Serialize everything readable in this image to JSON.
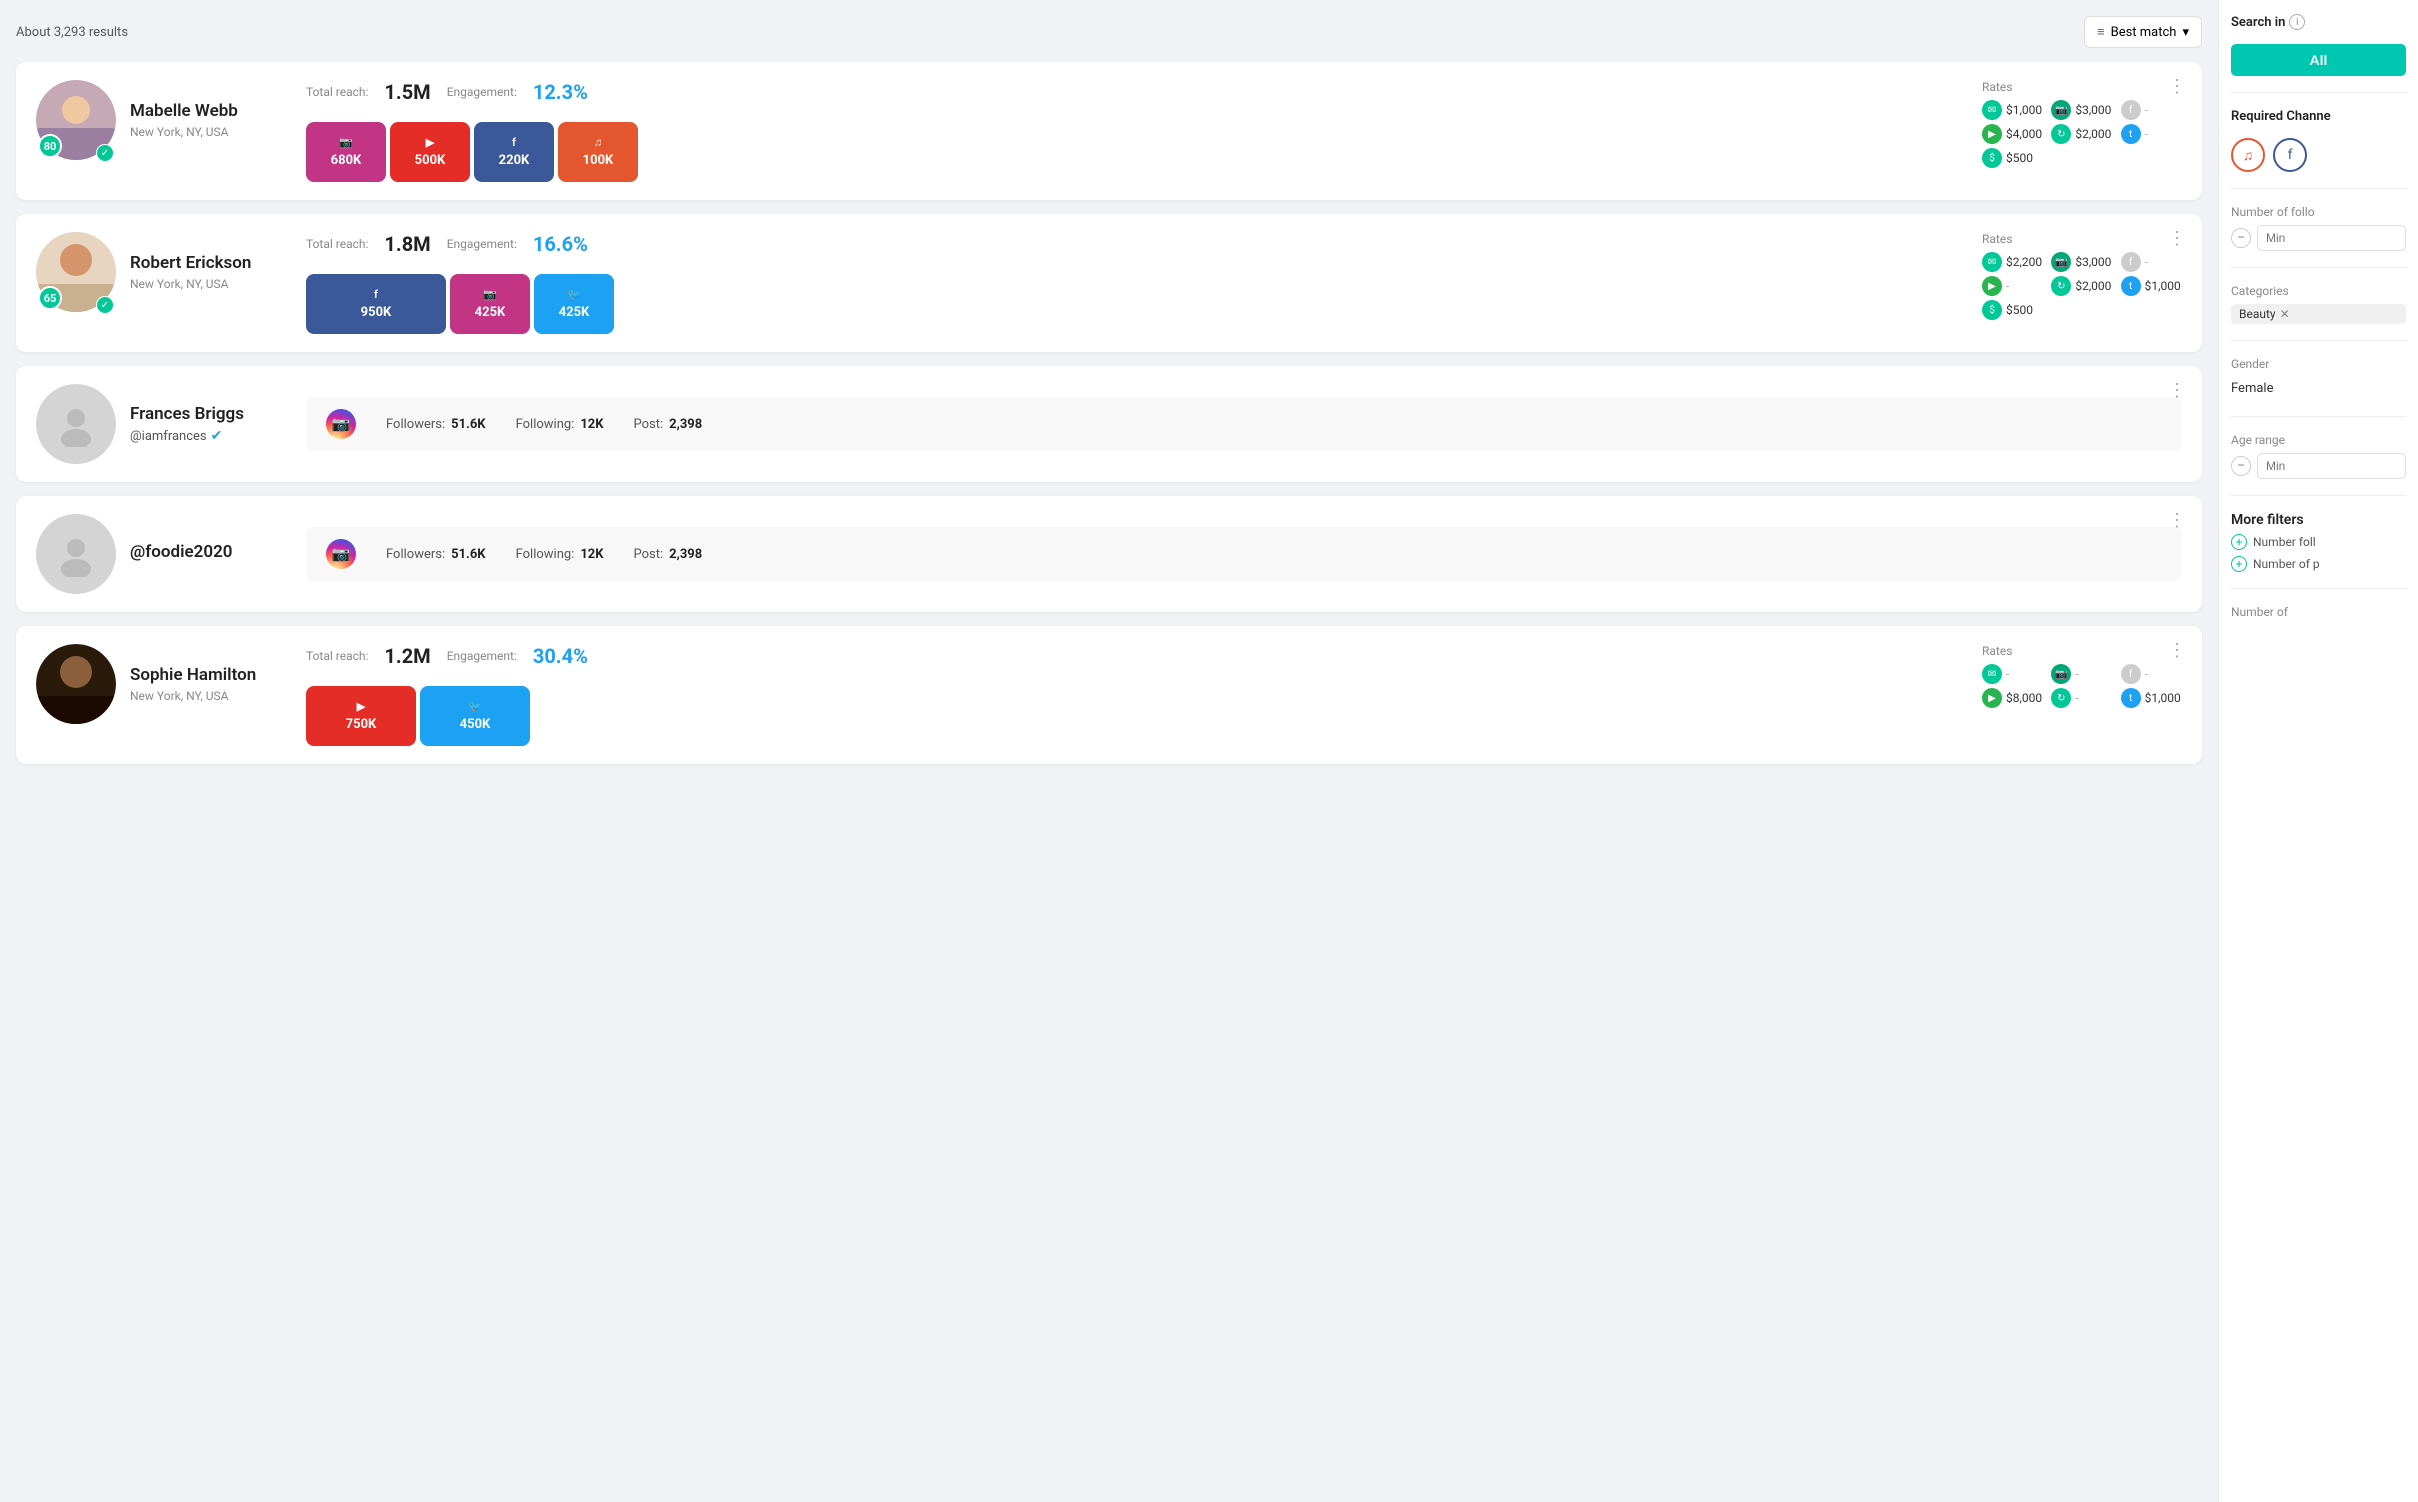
{
  "header": {
    "results_count": "About 3,293 results",
    "sort_label": "Best match",
    "sort_icon": "≡"
  },
  "sidebar": {
    "search_in_label": "Search in",
    "info_icon": "i",
    "all_button": "All",
    "required_channels_label": "Required Channe",
    "channels": [
      {
        "name": "spotify",
        "style": "req-spotify",
        "icon": "♫"
      },
      {
        "name": "facebook",
        "style": "req-facebook",
        "icon": "f"
      }
    ],
    "number_of_followers_label": "Number of follo",
    "min_placeholder": "Min",
    "categories_label": "Categories",
    "category_tag": "Beauty",
    "gender_label": "Gender",
    "gender_value": "Female",
    "age_range_label": "Age range",
    "age_min_placeholder": "Min",
    "more_filters_label": "More filters",
    "more_filter_items": [
      {
        "label": "Number foll"
      },
      {
        "label": "Number of p"
      }
    ],
    "number_of_label": "Number of"
  },
  "influencers": [
    {
      "id": 1,
      "name": "Mabelle Webb",
      "location": "New York, NY, USA",
      "score": "80",
      "verified": true,
      "total_reach": "1.5M",
      "engagement": "12.3%",
      "has_detailed_rates": true,
      "channels": [
        {
          "platform": "instagram",
          "count": "680K",
          "color": "#c13584",
          "icon": "📷"
        },
        {
          "platform": "youtube",
          "count": "500K",
          "color": "#e52d27",
          "icon": "▶"
        },
        {
          "platform": "facebook",
          "count": "220K",
          "color": "#3b5998",
          "icon": "f"
        },
        {
          "platform": "spotify",
          "count": "100K",
          "color": "#e4572e",
          "icon": "♫"
        }
      ],
      "rates": [
        {
          "icon": "msg",
          "value": "$1,000"
        },
        {
          "icon": "cam",
          "value": "$3,000"
        },
        {
          "icon": "dash",
          "value": "-"
        },
        {
          "icon": "play",
          "value": "$4,000"
        },
        {
          "icon": "refresh",
          "value": "$2,000"
        },
        {
          "icon": "twitter",
          "value": "-"
        },
        {
          "icon": "dollar",
          "value": "$500"
        }
      ]
    },
    {
      "id": 2,
      "name": "Robert Erickson",
      "location": "New York, NY, USA",
      "score": "65",
      "verified": true,
      "total_reach": "1.8M",
      "engagement": "16.6%",
      "has_detailed_rates": true,
      "channels": [
        {
          "platform": "facebook",
          "count": "950K",
          "color": "#3b5998",
          "icon": "f"
        },
        {
          "platform": "instagram",
          "count": "425K",
          "color": "#c13584",
          "icon": "📷"
        },
        {
          "platform": "twitter",
          "count": "425K",
          "color": "#1da1f2",
          "icon": "🐦"
        }
      ],
      "rates": [
        {
          "icon": "msg",
          "value": "$2,200"
        },
        {
          "icon": "cam",
          "value": "$3,000"
        },
        {
          "icon": "dash",
          "value": "-"
        },
        {
          "icon": "play",
          "value": "-"
        },
        {
          "icon": "refresh",
          "value": "$2,000"
        },
        {
          "icon": "twitter",
          "value": "$1,000"
        },
        {
          "icon": "dollar",
          "value": "$500"
        }
      ]
    },
    {
      "id": 3,
      "name": "Frances Briggs",
      "handle": "@iamfrances",
      "has_detailed_rates": false,
      "followers": "51.6K",
      "following": "12K",
      "posts": "2,398"
    },
    {
      "id": 4,
      "name": "@foodie2020",
      "handle": null,
      "has_detailed_rates": false,
      "followers": "51.6K",
      "following": "12K",
      "posts": "2,398"
    },
    {
      "id": 5,
      "name": "Sophie Hamilton",
      "location": "New York, NY, USA",
      "score": null,
      "verified": false,
      "total_reach": "1.2M",
      "engagement": "30.4%",
      "has_detailed_rates": true,
      "channels": [
        {
          "platform": "youtube",
          "count": "750K",
          "color": "#e52d27",
          "icon": "▶"
        },
        {
          "platform": "twitter",
          "count": "450K",
          "color": "#1da1f2",
          "icon": "🐦"
        }
      ],
      "rates": [
        {
          "icon": "msg",
          "value": "-"
        },
        {
          "icon": "cam",
          "value": "-"
        },
        {
          "icon": "dash",
          "value": "-"
        },
        {
          "icon": "play",
          "value": "$8,000"
        },
        {
          "icon": "refresh",
          "value": "-"
        },
        {
          "icon": "twitter",
          "value": "$1,000"
        }
      ]
    }
  ]
}
